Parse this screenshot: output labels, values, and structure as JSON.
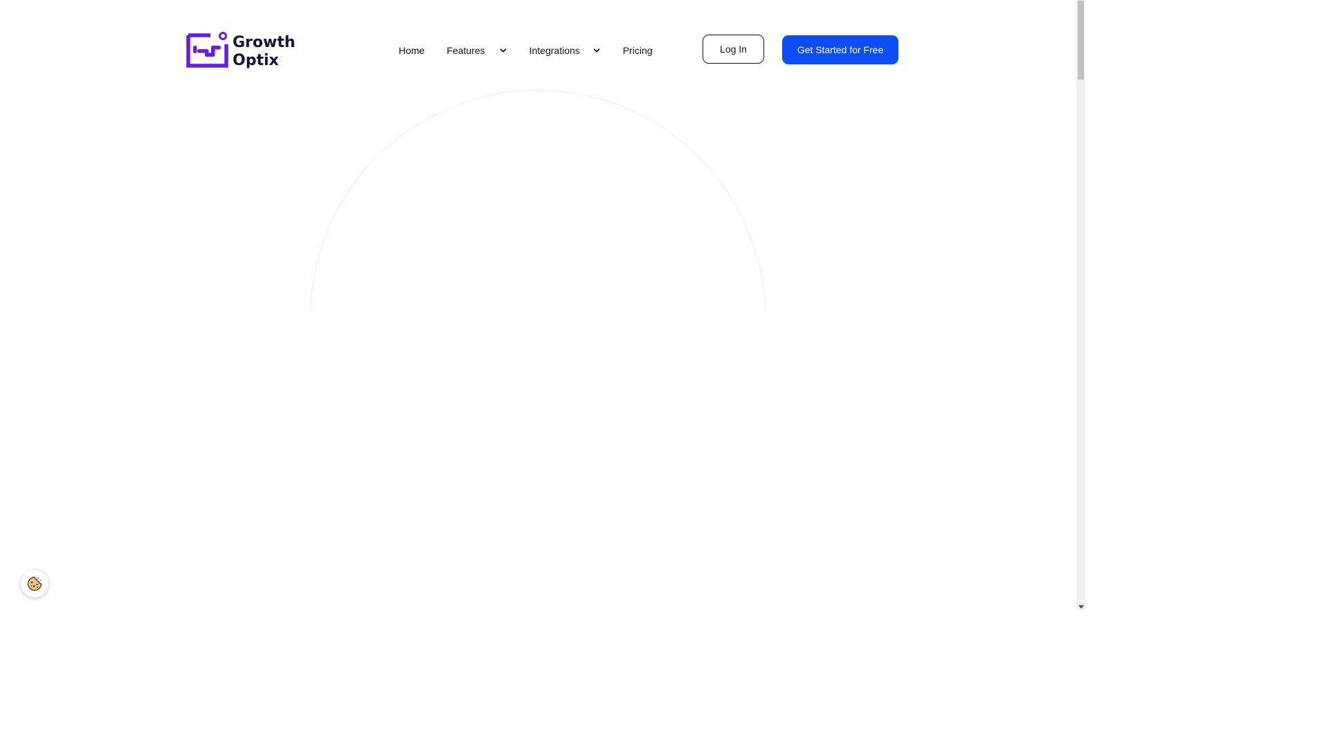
{
  "brand": {
    "line1": "Growth",
    "line2": "Optix",
    "purple": "#6b18e8",
    "navy": "#16133a"
  },
  "nav": {
    "home": "Home",
    "features": "Features",
    "integrations": "Integrations",
    "pricing": "Pricing"
  },
  "actions": {
    "login": "Log In",
    "cta": "Get Started for Free",
    "cta_color": "#0b4ef5"
  },
  "icons": {
    "features_chevron": "chevron-down-icon",
    "integrations_chevron": "chevron-down-icon",
    "cookie": "cookie-icon",
    "scroll_down": "scroll-down-arrow-icon"
  }
}
